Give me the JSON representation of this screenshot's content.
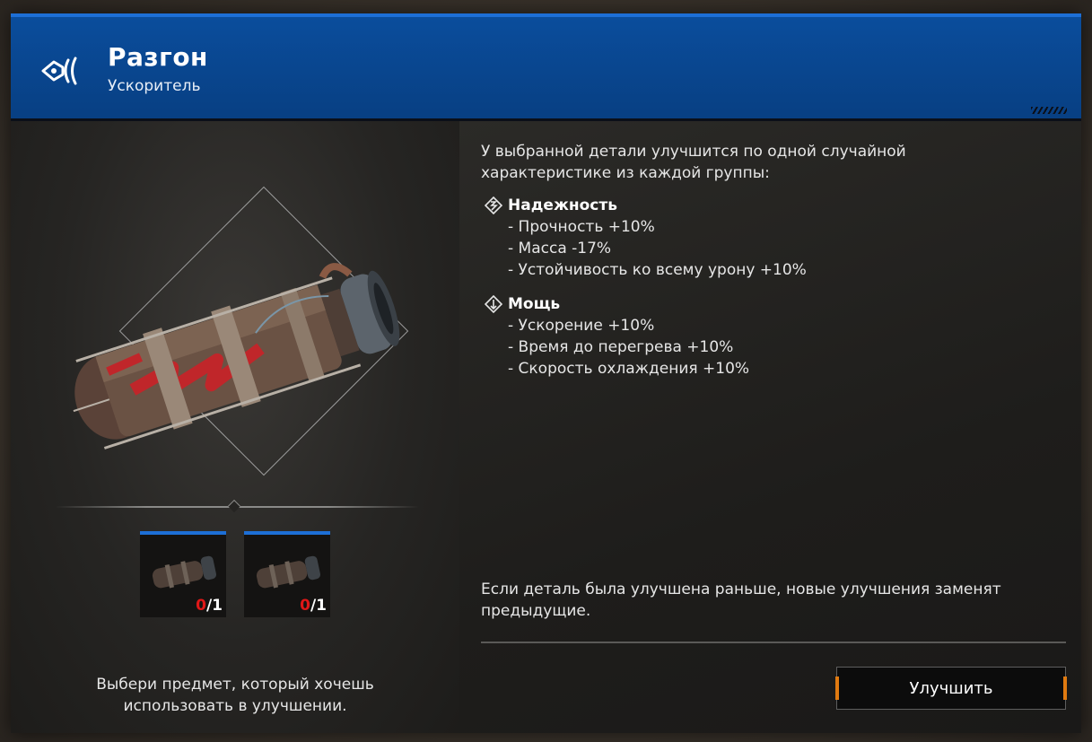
{
  "header": {
    "title": "Разгон",
    "subtitle": "Ускоритель",
    "icon": "booster-icon"
  },
  "left": {
    "item_icon": "booster-item-image",
    "slots": [
      {
        "current": "0",
        "sep": "/",
        "total": "1"
      },
      {
        "current": "0",
        "sep": "/",
        "total": "1"
      }
    ],
    "hint": "Выбери предмет, который хочешь использовать в улучшении."
  },
  "right": {
    "description": "У выбранной детали улучшится по одной случайной характеристике из каждой группы:",
    "groups": [
      {
        "title": "Надежность",
        "icon": "reliability-icon",
        "stats": [
          "- Прочность +10%",
          "- Масса -17%",
          "- Устойчивость ко всему урону +10%"
        ]
      },
      {
        "title": "Мощь",
        "icon": "power-icon",
        "stats": [
          "- Ускорение +10%",
          "- Время до перегрева +10%",
          "- Скорость охлаждения +10%"
        ]
      }
    ],
    "note": "Если деталь была улучшена раньше, новые улучшения заменят предыдущие.",
    "upgrade_label": "Улучшить"
  },
  "colors": {
    "header_blue": "#0a4d9c",
    "accent_blue": "#1d6fd6",
    "count_red": "#e01818",
    "button_tick": "#e07a10"
  }
}
